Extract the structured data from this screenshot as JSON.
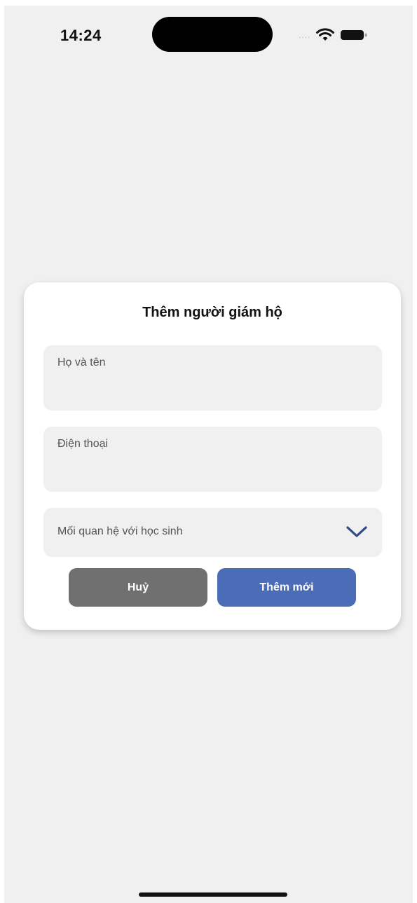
{
  "status_bar": {
    "time": "14:24",
    "signal": "....",
    "icons": [
      "wifi-icon",
      "battery-icon"
    ]
  },
  "dialog": {
    "title": "Thêm người giám hộ",
    "fields": {
      "full_name": {
        "placeholder": "Họ và tên",
        "value": ""
      },
      "phone": {
        "placeholder": "Điện thoại",
        "value": ""
      },
      "relationship": {
        "placeholder": "Mối quan hệ với học sinh",
        "icon": "chevron-down-icon"
      }
    },
    "buttons": {
      "cancel": "Huỷ",
      "add": "Thêm mới"
    }
  },
  "colors": {
    "background": "#f0f0f0",
    "card": "#ffffff",
    "field_bg": "#f0f0f0",
    "cancel_button": "#707070",
    "primary_button": "#4b6cb7",
    "chevron": "#2f4a8a"
  }
}
